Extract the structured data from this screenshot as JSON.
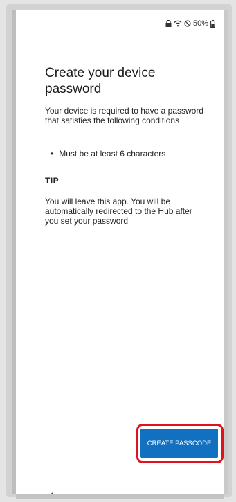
{
  "status_bar": {
    "battery_percent": "50%",
    "icons": [
      "lock-icon",
      "wifi-icon",
      "do-not-disturb-icon",
      "battery-icon"
    ]
  },
  "page": {
    "title": "Create your device password",
    "description": "Your device is required to have a password that satisfies the following conditions",
    "bullet_symbol": "•",
    "requirements": [
      "Must be at least 6 characters"
    ],
    "tip_heading": "TIP",
    "tip_text": "You will leave this app. You will be automatically redirected to the Hub after you set your password"
  },
  "actions": {
    "create_passcode_label": "CREATE PASSCODE"
  },
  "navigation": {
    "back_icon": "chevron-left-icon"
  },
  "colors": {
    "primary_button": "#1170c0",
    "highlight_border": "#e0121a",
    "text": "#222222"
  }
}
